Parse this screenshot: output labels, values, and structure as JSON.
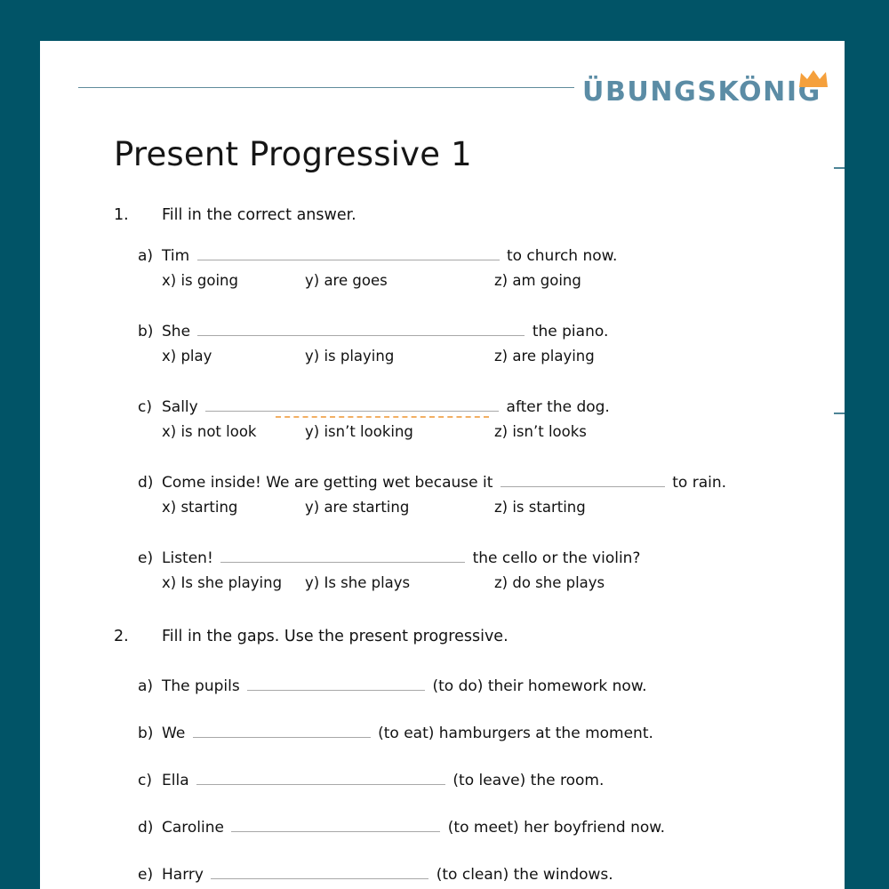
{
  "brand": {
    "logo_text": "ÜBUNGSKÖNIG",
    "logo_color": "#5b8ca5",
    "crown_color": "#f5a03c",
    "crown_icon": "crown-icon",
    "rule_color": "#5f8c9b"
  },
  "page": {
    "background": "#015467",
    "sheet_color": "#ffffff",
    "title": "Present Progressive 1"
  },
  "tasks": [
    {
      "number": "1.",
      "instruction": "Fill in the correct answer.",
      "items": [
        {
          "label": "a)",
          "before": "Tim",
          "after": "to church now.",
          "blank_width": 340,
          "options": [
            "x) is going",
            "y) are goes",
            "z) am going"
          ]
        },
        {
          "label": "b)",
          "before": "She",
          "after": "the piano.",
          "blank_width": 368,
          "options": [
            "x) play",
            "y) is playing",
            "z) are playing"
          ]
        },
        {
          "label": "c)",
          "before": "Sally",
          "after": "after the dog.",
          "blank_width": 330,
          "options": [
            "x) is not look",
            "y) isn’t looking",
            "z) isn’t looks"
          ]
        },
        {
          "label": "d)",
          "before": "Come inside! We are getting wet because it",
          "after": "to rain.",
          "blank_width": 185,
          "options": [
            "x) starting",
            "y) are starting",
            "z) is starting"
          ]
        },
        {
          "label": "e)",
          "before": "Listen!",
          "after": "the cello or the violin?",
          "blank_width": 275,
          "options": [
            "x) Is she playing",
            "y) Is she plays",
            "z) do she plays"
          ]
        }
      ]
    },
    {
      "number": "2.",
      "instruction": "Fill in the gaps. Use the present progressive.",
      "items": [
        {
          "label": "a)",
          "before": "The pupils",
          "after": "(to do) their homework now.",
          "blank_width": 200,
          "options": []
        },
        {
          "label": "b)",
          "before": "We",
          "after": "(to eat) hamburgers at the moment.",
          "blank_width": 200,
          "options": []
        },
        {
          "label": "c)",
          "before": "Ella",
          "after": "(to leave) the room.",
          "blank_width": 280,
          "options": []
        },
        {
          "label": "d)",
          "before": "Caroline",
          "after": "(to meet) her boyfriend now.",
          "blank_width": 235,
          "options": []
        },
        {
          "label": "e)",
          "before": "Harry",
          "after": "(to clean) the windows.",
          "blank_width": 245,
          "options": []
        }
      ]
    }
  ]
}
